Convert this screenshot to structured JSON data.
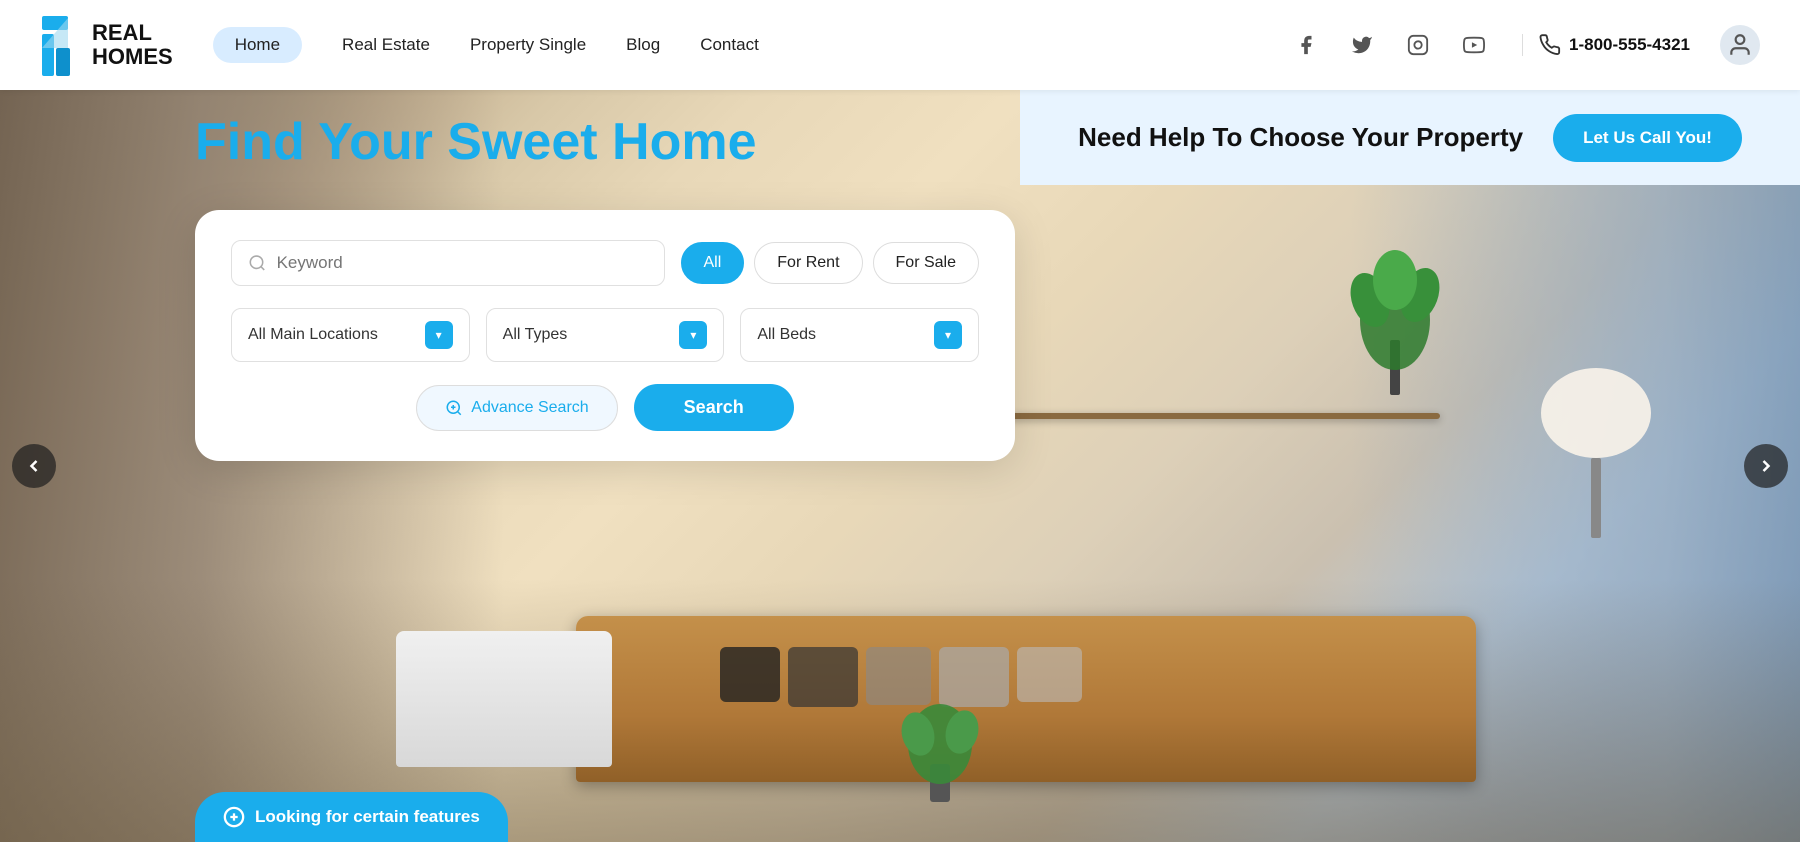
{
  "logo": {
    "text_line1": "REAL",
    "text_line2": "HOMES"
  },
  "nav": {
    "links": [
      {
        "label": "Home",
        "active": true
      },
      {
        "label": "Real Estate",
        "active": false
      },
      {
        "label": "Property Single",
        "active": false
      },
      {
        "label": "Blog",
        "active": false
      },
      {
        "label": "Contact",
        "active": false
      }
    ],
    "phone": "1-800-555-4321"
  },
  "hero": {
    "headline": "Find Your Sweet Home",
    "help_text": "Need Help To Choose Your Property",
    "call_btn": "Let Us Call You!"
  },
  "search": {
    "keyword_placeholder": "Keyword",
    "type_buttons": [
      {
        "label": "All",
        "active": true
      },
      {
        "label": "For Rent",
        "active": false
      },
      {
        "label": "For Sale",
        "active": false
      }
    ],
    "location_placeholder": "All Main Locations",
    "types_placeholder": "All Types",
    "beds_placeholder": "All Beds",
    "advance_label": "Advance Search",
    "search_label": "Search"
  },
  "features_btn": "Looking for certain features",
  "carousel": {
    "left_arrow": "‹",
    "right_arrow": "›"
  },
  "icons": {
    "search": "🔍",
    "phone": "📞",
    "facebook": "f",
    "twitter": "𝕏",
    "instagram": "◎",
    "youtube": "▶",
    "user": "👤",
    "plus_circle": "⊕",
    "advance_search": "🔍",
    "arrow_down": "▾",
    "circle_plus": "⊕"
  },
  "colors": {
    "primary": "#1aadec",
    "primary_light": "#e8f4ff",
    "text_dark": "#111111",
    "text_medium": "#555555",
    "border": "#e0e0e0",
    "white": "#ffffff"
  }
}
